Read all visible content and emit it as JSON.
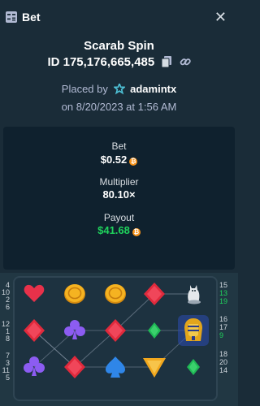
{
  "header": {
    "title": "Bet",
    "icon": "bet-slip-icon",
    "close_icon": "close-icon"
  },
  "bet_info": {
    "game_name": "Scarab Spin",
    "id_label": "ID 175,176,665,485",
    "placed_by_prefix": "Placed by",
    "username": "adamintx",
    "date_line": "on 8/20/2023 at 1:56 AM"
  },
  "stats": {
    "bet_label": "Bet",
    "bet_value": "$0.52",
    "multiplier_label": "Multiplier",
    "multiplier_value": "80.10×",
    "payout_label": "Payout",
    "payout_value": "$41.68",
    "currency_icon": "bitcoin-icon"
  },
  "paylines": {
    "left": [
      "4",
      "10",
      "2",
      "6",
      "12",
      "1",
      "8",
      "7",
      "3",
      "11",
      "5"
    ],
    "right": [
      "15",
      "13",
      "19",
      "16",
      "17",
      "9",
      "18",
      "20",
      "14"
    ],
    "winning": [
      "13",
      "19",
      "9"
    ],
    "win_color": "#1fd35c"
  },
  "grid": {
    "symbols": [
      [
        "heart",
        "coin",
        "coin",
        "red-diamond",
        "cat-statue"
      ],
      [
        "red-diamond",
        "purple-club",
        "red-diamond",
        "green-diamond",
        "pharaoh-mask"
      ],
      [
        "purple-club",
        "red-diamond",
        "blue-spade",
        "gold-triangle",
        "green-diamond"
      ]
    ]
  }
}
